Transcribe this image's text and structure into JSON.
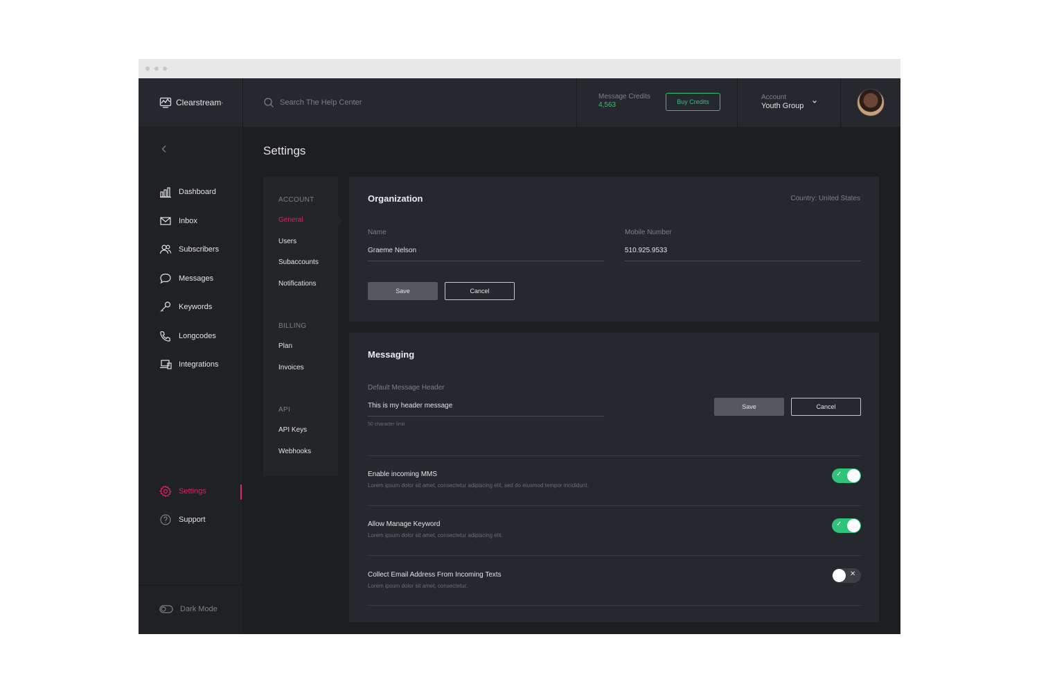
{
  "brand": {
    "name": "Clearstream",
    "trademark": "·"
  },
  "search": {
    "placeholder": "Search The Help Center"
  },
  "credits": {
    "label": "Message Credits",
    "value": "4,563",
    "buy_label": "Buy Credits"
  },
  "account": {
    "label": "Account",
    "name": "Youth Group"
  },
  "sidebar": {
    "items": [
      {
        "label": "Dashboard",
        "icon": "chart-icon"
      },
      {
        "label": "Inbox",
        "icon": "envelope-icon"
      },
      {
        "label": "Subscribers",
        "icon": "users-icon"
      },
      {
        "label": "Messages",
        "icon": "chat-icon"
      },
      {
        "label": "Keywords",
        "icon": "key-icon"
      },
      {
        "label": "Longcodes",
        "icon": "phone-icon"
      },
      {
        "label": "Integrations",
        "icon": "devices-icon"
      }
    ],
    "settings_label": "Settings",
    "support_label": "Support",
    "dark_mode_label": "Dark Mode"
  },
  "page": {
    "title": "Settings"
  },
  "subnav": {
    "account_heading": "ACCOUNT",
    "account_items": [
      "General",
      "Users",
      "Subaccounts",
      "Notifications"
    ],
    "billing_heading": "BILLING",
    "billing_items": [
      "Plan",
      "Invoices"
    ],
    "api_heading": "API",
    "api_items": [
      "API Keys",
      "Webhooks"
    ]
  },
  "organization": {
    "title": "Organization",
    "country": "Country: United States",
    "name_label": "Name",
    "name_value": "Graeme Nelson",
    "mobile_label": "Mobile Number",
    "mobile_value": "510.925.9533",
    "save_label": "Save",
    "cancel_label": "Cancel"
  },
  "messaging": {
    "title": "Messaging",
    "header_label": "Default Message Header",
    "header_value": "This is my header message",
    "hint": "50 character limit",
    "save_label": "Save",
    "cancel_label": "Cancel",
    "toggles": [
      {
        "title": "Enable incoming MMS",
        "desc": "Lorem ipsum dolor sit amet, consectetur adipiscing elit, sed do eiusmod tempor incididunt.",
        "on": true
      },
      {
        "title": "Allow Manage Keyword",
        "desc": "Lorem ipsum dolor sit amet, consectetur adipiscing elit.",
        "on": true
      },
      {
        "title": "Collect Email Address From Incoming Texts",
        "desc": "Lorem ipsum dolor sit amet, consectetur.",
        "on": false
      }
    ]
  },
  "colors": {
    "accent": "#e0245e",
    "success": "#2fc379",
    "background": "#1c1e22",
    "panel": "#25282d"
  }
}
